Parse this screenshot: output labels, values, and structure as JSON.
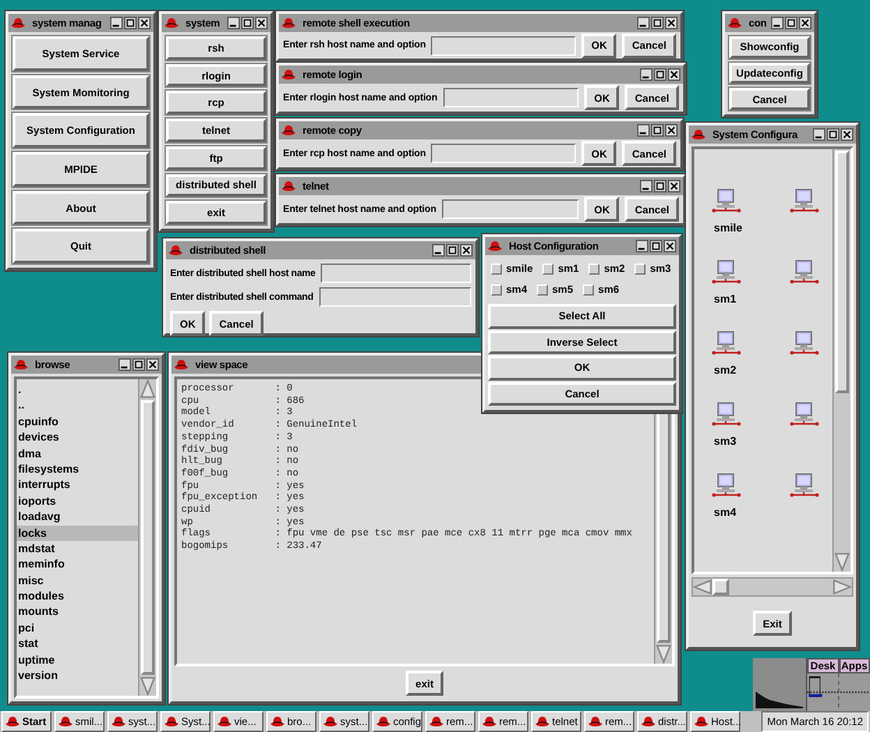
{
  "windows": [
    {
      "kind": "button_menu",
      "title": "system manag",
      "buttons": [
        "System Service",
        "System Momitoring",
        "System Configuration",
        "MPIDE",
        "About",
        "Quit"
      ]
    },
    {
      "kind": "button_menu",
      "title": "system",
      "buttons": [
        "rsh",
        "rlogin",
        "rcp",
        "telnet",
        "ftp",
        "distributed shell",
        "exit"
      ]
    },
    {
      "kind": "prompt",
      "title": "remote shell execution",
      "label": "Enter rsh host name and option",
      "buttons": [
        "OK",
        "Cancel"
      ]
    },
    {
      "kind": "prompt",
      "title": "remote login",
      "label": "Enter rlogin host name and option",
      "buttons": [
        "OK",
        "Cancel"
      ]
    },
    {
      "kind": "prompt",
      "title": "remote copy",
      "label": "Enter rcp host name and option",
      "buttons": [
        "OK",
        "Cancel"
      ]
    },
    {
      "kind": "prompt",
      "title": "telnet",
      "label": "Enter telnet host name and option",
      "buttons": [
        "OK",
        "Cancel"
      ]
    },
    {
      "kind": "button_menu",
      "title": "con",
      "buttons": [
        "Showconfig",
        "Updateconfig",
        "Cancel"
      ]
    },
    {
      "kind": "host_grid",
      "title": "System Configura",
      "hosts": [
        {
          "label": "smile"
        },
        {
          "label": "sm1"
        },
        {
          "label": "sm2"
        },
        {
          "label": "sm3"
        },
        {
          "label": "sm4"
        }
      ],
      "button": "Exit"
    },
    {
      "kind": "form",
      "title": "distributed shell",
      "fields": [
        {
          "label": "Enter distributed shell host name"
        },
        {
          "label": "Enter distributed shell command"
        }
      ],
      "buttons": [
        "OK",
        "Cancel"
      ]
    },
    {
      "kind": "checklist",
      "title": "Host Configuration",
      "options": [
        {
          "label": "smile",
          "checked": false
        },
        {
          "label": "sm1",
          "checked": false
        },
        {
          "label": "sm2",
          "checked": false
        },
        {
          "label": "sm3",
          "checked": false
        },
        {
          "label": "sm4",
          "checked": false
        },
        {
          "label": "sm5",
          "checked": false
        },
        {
          "label": "sm6",
          "checked": false
        }
      ],
      "buttons": [
        "Select All",
        "Inverse Select",
        "OK",
        "Cancel"
      ]
    },
    {
      "kind": "file_list",
      "title": "browse",
      "items": [
        {
          "label": ".",
          "selected": false
        },
        {
          "label": "..",
          "selected": false
        },
        {
          "label": "cpuinfo",
          "selected": false
        },
        {
          "label": "devices",
          "selected": false
        },
        {
          "label": "dma",
          "selected": false
        },
        {
          "label": "filesystems",
          "selected": false
        },
        {
          "label": "interrupts",
          "selected": false
        },
        {
          "label": "ioports",
          "selected": false
        },
        {
          "label": "loadavg",
          "selected": false
        },
        {
          "label": "locks",
          "selected": true
        },
        {
          "label": "mdstat",
          "selected": false
        },
        {
          "label": "meminfo",
          "selected": false
        },
        {
          "label": "misc",
          "selected": false
        },
        {
          "label": "modules",
          "selected": false
        },
        {
          "label": "mounts",
          "selected": false
        },
        {
          "label": "pci",
          "selected": false
        },
        {
          "label": "stat",
          "selected": false
        },
        {
          "label": "uptime",
          "selected": false
        },
        {
          "label": "version",
          "selected": false
        }
      ]
    },
    {
      "kind": "text_view",
      "title": "view space",
      "lines": [
        "processor       : 0",
        "cpu             : 686",
        "model           : 3",
        "vendor_id       : GenuineIntel",
        "stepping        : 3",
        "fdiv_bug        : no",
        "hlt_bug         : no",
        "f00f_bug        : no",
        "fpu             : yes",
        "fpu_exception   : yes",
        "cpuid           : yes",
        "wp              : yes",
        "flags           : fpu vme de pse tsc msr pae mce cx8 11 mtrr pge mca cmov mmx",
        "bogomips        : 233.47"
      ],
      "button": "exit"
    }
  ],
  "pager": {
    "desks": [
      "Desk",
      "Apps"
    ]
  },
  "taskbar": {
    "start": "Start",
    "tasks": [
      "smil...",
      "syst...",
      "Syst...",
      "vie...",
      "bro...",
      "syst...",
      "config",
      "rem...",
      "rem...",
      "telnet",
      "rem...",
      "distr...",
      "Host..."
    ],
    "clock": "Mon March 16 20:12"
  }
}
